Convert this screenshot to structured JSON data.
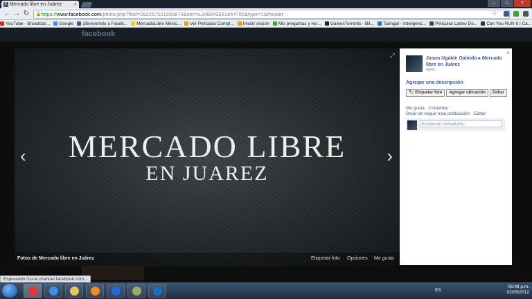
{
  "browser": {
    "tab_title": "Mercado libre en Juárez",
    "tab_close": "×",
    "favicon_letter": "f",
    "window_buttons": [
      "–",
      "□",
      "×"
    ],
    "url_scheme": "https://",
    "url_host": "www.facebook.com",
    "url_path": "/photo.php?fbid=282267521865879&set=a.348843581844705&type=1&theater",
    "nav": {
      "back": "←",
      "forward": "→",
      "reload": "↻",
      "star": "☆"
    }
  },
  "bookmarks": [
    {
      "label": "YouTube - Broadcas...",
      "color": "#d22"
    },
    {
      "label": "Google",
      "color": "#4a8af4"
    },
    {
      "label": "¡Bienvenido a Faceb...",
      "color": "#3b5998"
    },
    {
      "label": "MercadoLibre Méxic...",
      "color": "#f5d300"
    },
    {
      "label": "Ver Peliculas Compl...",
      "color": "#e8a000"
    },
    {
      "label": "Iniciar sesión",
      "color": "#f90"
    },
    {
      "label": "Mis preguntas y res...",
      "color": "#3a3"
    },
    {
      "label": "GamesTorrents - Bit...",
      "color": "#222"
    },
    {
      "label": "Taringa! - Inteligenc...",
      "color": "#27c"
    },
    {
      "label": "Peliculas Latino Do...",
      "color": "#444"
    },
    {
      "label": "Can You RUN It | Ca...",
      "color": "#333"
    }
  ],
  "facebook": {
    "logo": "facebook"
  },
  "photo": {
    "line1": "MERCADO LIBRE",
    "line2": "EN JUAREZ",
    "prev": "‹",
    "next": "›",
    "expand": "⤢",
    "album_title": "Fotos de Mercado libre en Juárez",
    "actions": [
      "Etiquetar foto",
      "Opciones",
      "Me gusta"
    ]
  },
  "sidebar": {
    "close": "×",
    "owner": "Jason Ugalde Galindo ▸ Mercado libre en Juárez",
    "time": "Ayer ",
    "add_description": "Agregar una descripción",
    "buttons": [
      "🏷 Etiquetar foto",
      "Agregar ubicación",
      "Editar"
    ],
    "like": "Me gusta",
    "comment": "Comentar",
    "unfollow": "Dejar de seguir esta publicación",
    "edit": "Editar",
    "comment_placeholder": "Escribe un comentario..."
  },
  "status_bar": "Esperando 0-p-w.channel.facebook.com...",
  "taskbar": {
    "lang": "ES",
    "time": "06:48 p.m.",
    "date": "02/05/2012",
    "apps": [
      {
        "name": "chrome",
        "color": "#e33"
      },
      {
        "name": "ie",
        "color": "#3a8ee6"
      },
      {
        "name": "explorer",
        "color": "#e8c35a"
      },
      {
        "name": "media-player",
        "color": "#f08a1c"
      },
      {
        "name": "wmp",
        "color": "#1d6ad6"
      },
      {
        "name": "paint",
        "color": "#9a6"
      },
      {
        "name": "hp",
        "color": "#1a6fc0"
      }
    ]
  }
}
